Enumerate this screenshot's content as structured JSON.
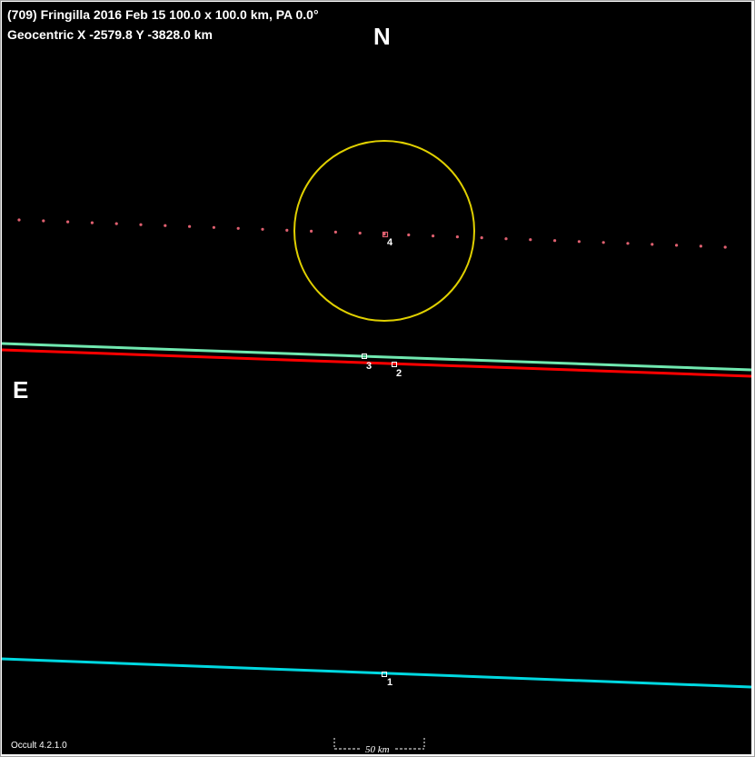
{
  "header": {
    "line1": "(709) Fringilla  2016 Feb 15   100.0 x 100.0 km, PA 0.0°",
    "line2": "Geocentric  X  -2579.8  Y  -3828.0 km"
  },
  "compass": {
    "north": "N",
    "east": "E"
  },
  "colors": {
    "background": "#000000",
    "asteroid_outline": "#e0d000",
    "path_dots": "#e06070",
    "chord_1": "#00d8e0",
    "chord_2": "#ff0000",
    "chord_3": "#70e8b0"
  },
  "asteroid": {
    "shape": "circle",
    "diameter_km": 100.0
  },
  "chords": [
    {
      "id": "chord-1",
      "label": "1",
      "color": "#00d8e0"
    },
    {
      "id": "chord-2",
      "label": "2",
      "color": "#ff0000"
    },
    {
      "id": "chord-3",
      "label": "3",
      "color": "#70e8b0"
    },
    {
      "id": "chord-4",
      "label": "4",
      "color": "#e06070"
    }
  ],
  "footer": {
    "version": "Occult 4.2.1.0",
    "scale_label": "50 km"
  }
}
